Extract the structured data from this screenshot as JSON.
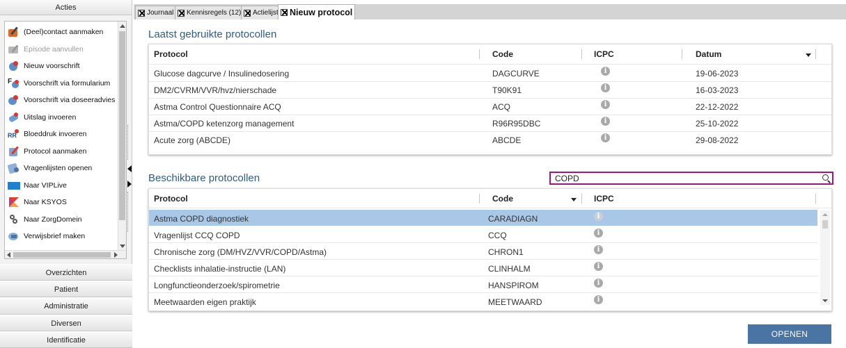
{
  "left_panel": {
    "header": "Acties",
    "actions": [
      {
        "label": "(Deel)contact aanmaken",
        "icon": "contact-pen-icon",
        "enabled": true
      },
      {
        "label": "Episode aanvullen",
        "icon": "episode-icon",
        "enabled": false
      },
      {
        "label": "Nieuw voorschrift",
        "icon": "prescription-icon",
        "enabled": true
      },
      {
        "label": "Voorschrift via formularium",
        "icon": "formulary-icon",
        "enabled": true
      },
      {
        "label": "Voorschrift via doseeradvies",
        "icon": "dosage-advice-icon",
        "enabled": true
      },
      {
        "label": "Uitslag invoeren",
        "icon": "result-icon",
        "enabled": true
      },
      {
        "label": "Bloeddruk invoeren",
        "icon": "blood-pressure-icon",
        "enabled": true
      },
      {
        "label": "Protocol aanmaken",
        "icon": "protocol-icon",
        "enabled": true
      },
      {
        "label": "Vragenlijsten openen",
        "icon": "questionnaire-icon",
        "enabled": true
      },
      {
        "label": "Naar VIPLive",
        "icon": "viplive-icon",
        "enabled": true
      },
      {
        "label": "Naar KSYOS",
        "icon": "ksyos-icon",
        "enabled": true
      },
      {
        "label": "Naar ZorgDomein",
        "icon": "zorgdomein-icon",
        "enabled": true
      },
      {
        "label": "Verwijsbrief maken",
        "icon": "referral-letter-icon",
        "enabled": true
      }
    ],
    "sections": [
      "Overzichten",
      "Patient",
      "Administratie",
      "Diversen",
      "Identificatie"
    ]
  },
  "tabs": [
    {
      "label": "Journaal",
      "active": false
    },
    {
      "label": "Kennisregels (12)",
      "active": false
    },
    {
      "label": "Actielijst",
      "active": false
    },
    {
      "label": "Nieuw protocol",
      "active": true
    }
  ],
  "recent": {
    "title": "Laatst gebruikte protocollen",
    "headers": {
      "protocol": "Protocol",
      "code": "Code",
      "icpc": "ICPC",
      "date": "Datum"
    },
    "rows": [
      {
        "protocol": "Glucose dagcurve / Insulinedosering",
        "code": "DAGCURVE",
        "date": "19-06-2023"
      },
      {
        "protocol": "DM2/CVRM/VVR/hvz/nierschade",
        "code": "T90K91",
        "date": "16-03-2023"
      },
      {
        "protocol": "Astma Control Questionnaire ACQ",
        "code": "ACQ",
        "date": "22-12-2022"
      },
      {
        "protocol": "Astma/COPD ketenzorg management",
        "code": "R96R95DBC",
        "date": "25-10-2022"
      },
      {
        "protocol": "Acute zorg (ABCDE)",
        "code": "ABCDE",
        "date": "29-08-2022"
      }
    ]
  },
  "available": {
    "title": "Beschikbare protocollen",
    "search_value": "COPD",
    "headers": {
      "protocol": "Protocol",
      "code": "Code",
      "icpc": "ICPC"
    },
    "rows": [
      {
        "protocol": "Astma COPD diagnostiek",
        "code": "CARADIAGN",
        "selected": true
      },
      {
        "protocol": "Vragenlijst CCQ COPD",
        "code": "CCQ",
        "selected": false
      },
      {
        "protocol": "Chronische zorg (DM/HVZ/VVR/COPD/Astma)",
        "code": "CHRON1",
        "selected": false
      },
      {
        "protocol": "Checklists inhalatie-instructie (LAN)",
        "code": "CLINHALM",
        "selected": false
      },
      {
        "protocol": "Longfunctieonderzoek/spirometrie",
        "code": "HANSPIROM",
        "selected": false
      },
      {
        "protocol": "Meetwaarden eigen praktijk",
        "code": "MEETWAARD",
        "selected": false
      }
    ]
  },
  "open_button": "OPENEN",
  "colors": {
    "accent": "#2d5d88",
    "selection": "#a9c7e6",
    "search_border": "#a3147c",
    "button": "#4a74a3"
  }
}
